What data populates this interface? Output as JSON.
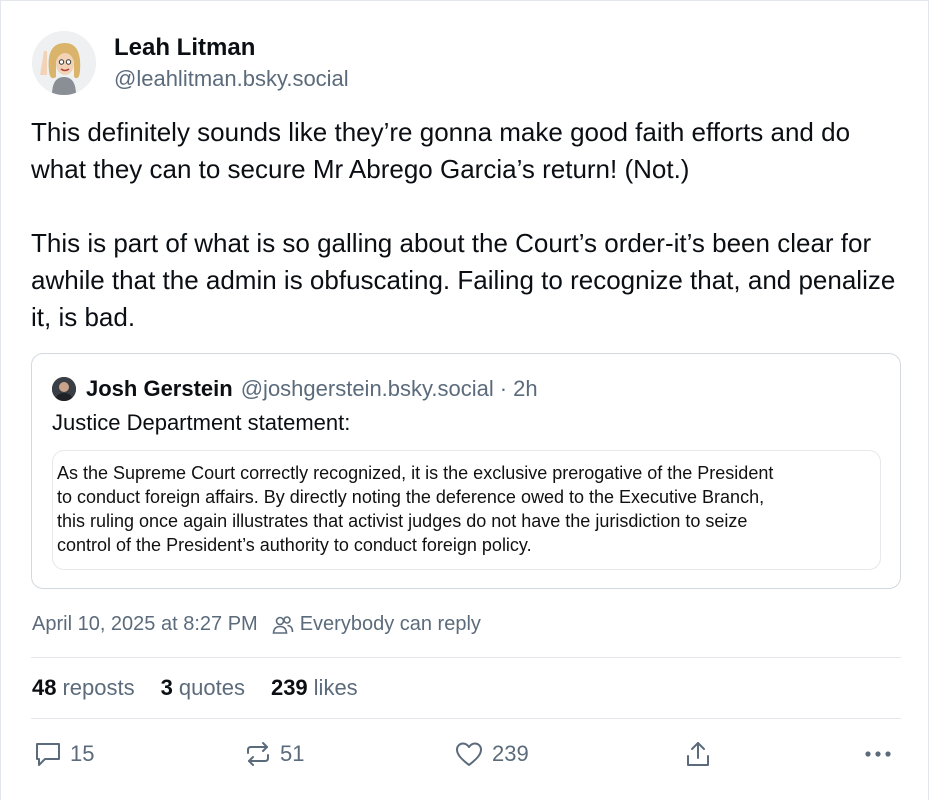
{
  "author": {
    "display_name": "Leah Litman",
    "handle": "@leahlitman.bsky.social",
    "avatar_icon": "cartoon-avatar-icon"
  },
  "post": {
    "paragraphs": [
      "This definitely sounds like they’re gonna make good faith efforts and do what they can to secure Mr Abrego Garcia’s return! (Not.)",
      "This is part of what is so galling about the Court’s order-it’s been clear for awhile that the admin is obfuscating. Failing to recognize that, and penalize it, is bad."
    ]
  },
  "quote": {
    "display_name": "Josh Gerstein",
    "handle": "@joshgerstein.bsky.social",
    "separator": "·",
    "time": "2h",
    "text": "Justice Department statement:",
    "embedded_lines": [
      "As the Supreme Court correctly recognized, it is the exclusive prerogative of the President",
      "to conduct foreign affairs.  By directly noting the deference owed to the Executive Branch,",
      "this ruling once again illustrates that activist judges do not have the jurisdiction to seize",
      "control of the President’s authority to conduct foreign policy."
    ]
  },
  "meta": {
    "timestamp": "April 10, 2025 at 8:27 PM",
    "reply_setting": "Everybody can reply"
  },
  "stats": {
    "reposts_count": "48",
    "reposts_label": "reposts",
    "quotes_count": "3",
    "quotes_label": "quotes",
    "likes_count": "239",
    "likes_label": "likes"
  },
  "actions": {
    "reply_count": "15",
    "repost_count": "51",
    "like_count": "239"
  },
  "colors": {
    "text": "#0b0f14",
    "muted": "#5b6b7b",
    "border": "#d4d9de"
  }
}
